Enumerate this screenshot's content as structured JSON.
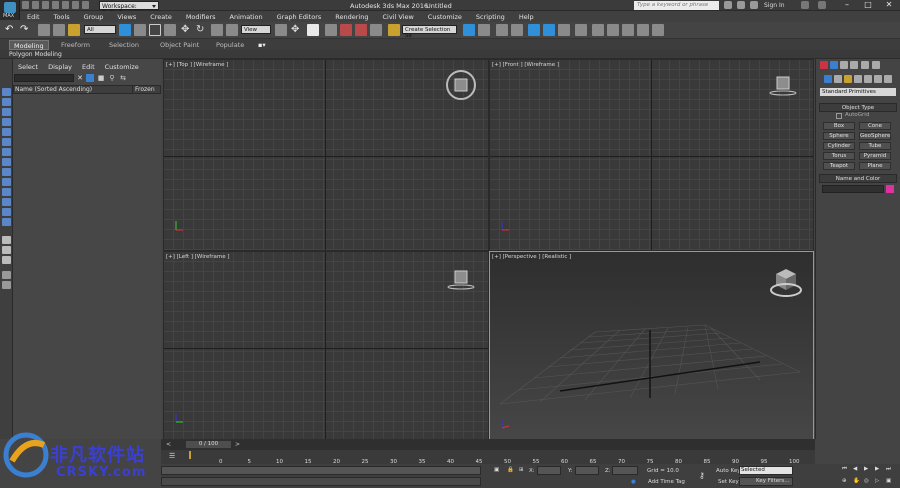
{
  "app": {
    "title": "Autodesk 3ds Max 2016",
    "document": "Untitled",
    "logo_label": "MAX",
    "workspace": "Workspace: Default",
    "search_placeholder": "Type a keyword or phrase",
    "sign_in": "Sign In"
  },
  "menu": [
    "Edit",
    "Tools",
    "Group",
    "Views",
    "Create",
    "Modifiers",
    "Animation",
    "Graph Editors",
    "Rendering",
    "Civil View",
    "Customize",
    "Scripting",
    "Help"
  ],
  "toolbar": {
    "selection_filter": "All",
    "reference_coord": "View",
    "named_selection": "Create Selection Se"
  },
  "ribbon": {
    "tabs": [
      "Modeling",
      "Freeform",
      "Selection",
      "Object Paint",
      "Populate"
    ],
    "active": "Modeling",
    "panel": "Polygon Modeling"
  },
  "scene_explorer": {
    "menu": [
      "Select",
      "Display",
      "Edit",
      "Customize"
    ],
    "columns": [
      "Name (Sorted Ascending)",
      "Frozen"
    ]
  },
  "viewports": [
    {
      "label": "[+] [Top ] [Wireframe ]"
    },
    {
      "label": "[+] [Front ] [Wireframe ]"
    },
    {
      "label": "[+] [Left ] [Wireframe ]"
    },
    {
      "label": "[+] [Perspective ] [Realistic ]"
    }
  ],
  "command_panel": {
    "category": "Standard Primitives",
    "object_type_title": "Object Type",
    "autogrid": "AutoGrid",
    "objects": [
      "Box",
      "Cone",
      "Sphere",
      "GeoSphere",
      "Cylinder",
      "Tube",
      "Torus",
      "Pyramid",
      "Teapot",
      "Plane"
    ],
    "name_color_title": "Name and Color",
    "object_color": "#e031a0"
  },
  "timeline": {
    "frame_display": "0 / 100",
    "ticks": [
      "0",
      "5",
      "10",
      "15",
      "20",
      "25",
      "30",
      "35",
      "40",
      "45",
      "50",
      "55",
      "60",
      "65",
      "70",
      "75",
      "80",
      "85",
      "90",
      "95",
      "100"
    ]
  },
  "status": {
    "x_label": "X:",
    "y_label": "Y:",
    "z_label": "Z:",
    "grid": "Grid = 10.0",
    "add_time_tag": "Add Time Tag",
    "auto_key": "Auto Key",
    "selected": "Selected",
    "set_key": "Set Key",
    "key_filters": "Key Filters..."
  },
  "watermark": {
    "cn": "非凡软件站",
    "en": "CRSKY.com"
  }
}
